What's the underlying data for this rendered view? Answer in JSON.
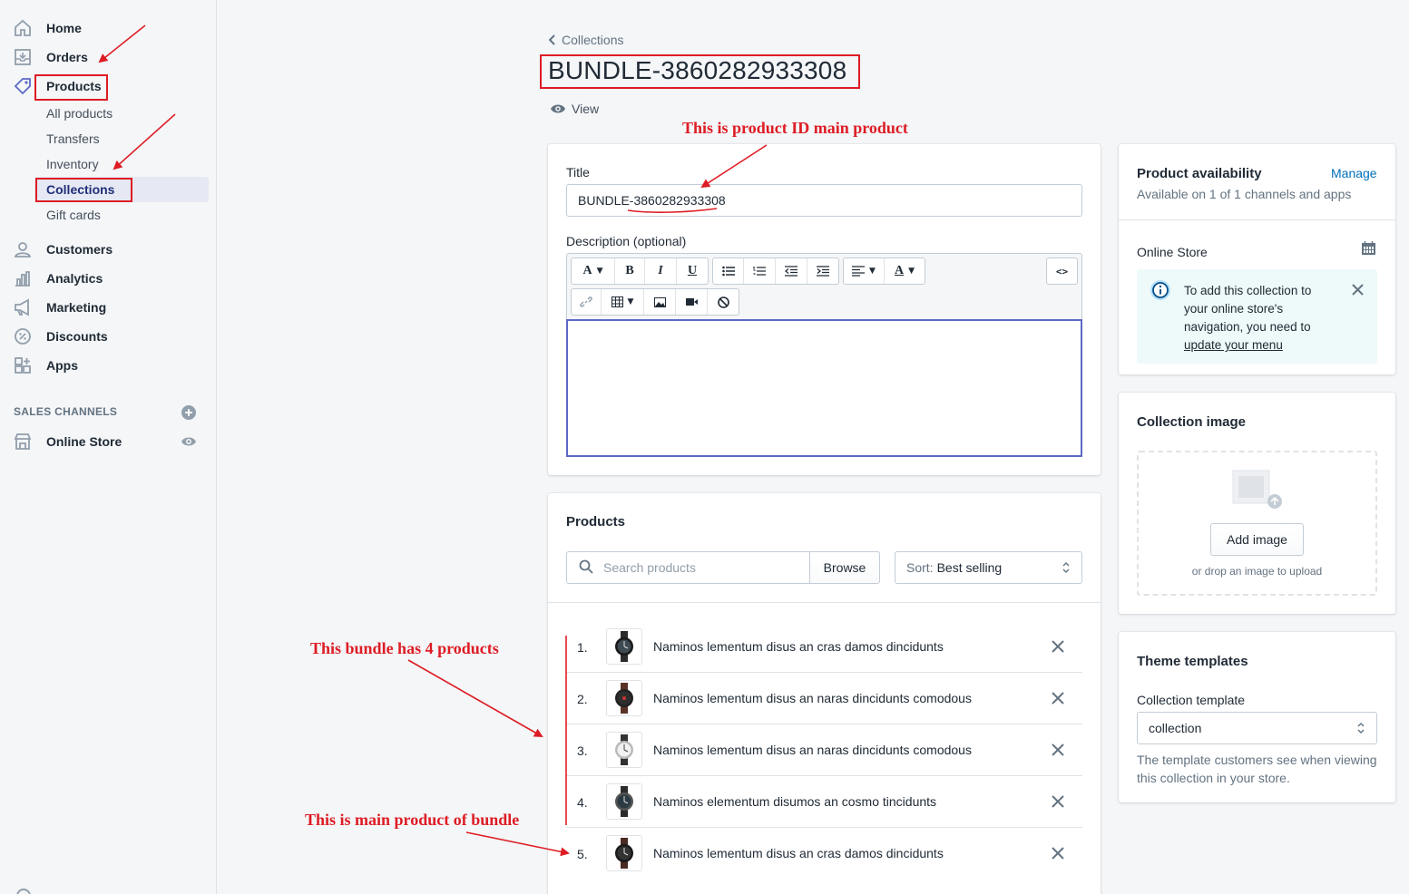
{
  "sidebar": {
    "nav": [
      {
        "label": "Home",
        "icon": "home-icon"
      },
      {
        "label": "Orders",
        "icon": "orders-icon"
      },
      {
        "label": "Products",
        "icon": "tag-icon"
      }
    ],
    "product_sub": [
      "All products",
      "Transfers",
      "Inventory",
      "Collections",
      "Gift cards"
    ],
    "nav2": [
      {
        "label": "Customers",
        "icon": "customers-icon"
      },
      {
        "label": "Analytics",
        "icon": "analytics-icon"
      },
      {
        "label": "Marketing",
        "icon": "marketing-icon"
      },
      {
        "label": "Discounts",
        "icon": "discounts-icon"
      },
      {
        "label": "Apps",
        "icon": "apps-icon"
      }
    ],
    "sales_channels_title": "SALES CHANNELS",
    "online_store": "Online Store"
  },
  "header": {
    "breadcrumb": "Collections",
    "title": "BUNDLE-3860282933308",
    "view_label": "View"
  },
  "collection_form": {
    "title_label": "Title",
    "title_value": "BUNDLE-3860282933308",
    "description_label": "Description (optional)"
  },
  "products_card": {
    "heading": "Products",
    "search_placeholder": "Search products",
    "browse_label": "Browse",
    "sort_prefix": "Sort:",
    "sort_value": "Best selling",
    "items": [
      {
        "num": "1.",
        "name": "Naminos lementum disus an cras damos dincidunts"
      },
      {
        "num": "2.",
        "name": "Naminos lementum disus an naras dincidunts comodous"
      },
      {
        "num": "3.",
        "name": "Naminos lementum disus an naras dincidunts comodous"
      },
      {
        "num": "4.",
        "name": "Naminos elementum disumos an cosmo tincidunts"
      },
      {
        "num": "5.",
        "name": "Naminos lementum disus an cras damos dincidunts"
      }
    ]
  },
  "availability": {
    "heading": "Product availability",
    "manage_label": "Manage",
    "subtext": "Available on 1 of 1 channels and apps",
    "channel": "Online Store",
    "banner": {
      "line1": "To add this collection to",
      "line2": "your online store's",
      "line3": "navigation, you need to",
      "link": "update your menu"
    }
  },
  "collection_image": {
    "heading": "Collection image",
    "add_label": "Add image",
    "drop_text": "or drop an image to upload"
  },
  "theme_templates": {
    "heading": "Theme templates",
    "label": "Collection template",
    "value": "collection",
    "help1": "The template customers see when viewing",
    "help2": "this collection in your store."
  },
  "annotations": {
    "id_note": "This is product ID main product",
    "bundle_note": "This bundle has 4 products",
    "main_note": "This is main product of bundle"
  },
  "colors": {
    "accent": "#5c6ac4",
    "annotation": "#de1c24",
    "link": "#006fbb"
  }
}
